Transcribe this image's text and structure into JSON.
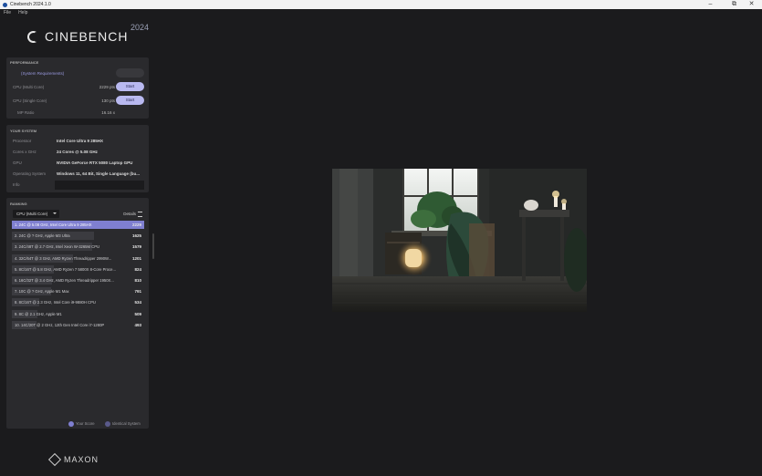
{
  "window": {
    "title": "Cinebench 2024.1.0"
  },
  "menu": {
    "items": [
      "File",
      "Help"
    ]
  },
  "logo": {
    "name": "CINEBENCH",
    "year": "2024"
  },
  "performance": {
    "title": "PERFORMANCE",
    "system_requirements": "(System Requirements)",
    "tests": [
      {
        "label": "CPU (Multi Core)",
        "score": "2229 pts",
        "button": "Start"
      },
      {
        "label": "CPU (Single Core)",
        "score": "130 pts",
        "button": "Start"
      }
    ],
    "mp_ratio": {
      "label": "MP Ratio",
      "value": "16.16 x"
    }
  },
  "system": {
    "title": "YOUR SYSTEM",
    "rows": [
      {
        "label": "Processor",
        "value": "Intel Core Ultra 9 285HX"
      },
      {
        "label": "Cores x GHz",
        "value": "24 Cores @ 5.08 GHz"
      },
      {
        "label": "GPU",
        "value": "NVIDIA GeForce RTX 5080 Laptop GPU"
      },
      {
        "label": "Operating System",
        "value": "Windows 11, 64 Bit, Single Language (bu..."
      },
      {
        "label": "Info",
        "value": ""
      }
    ]
  },
  "ranking": {
    "title": "RANKING",
    "dropdown": "CPU (Multi Core)",
    "details": "Details",
    "rows": [
      {
        "name": "1. 24C @ 5.08 GHz, Intel Core Ultra 9 285HX",
        "score": "2229",
        "fraction": 1.0
      },
      {
        "name": "2. 24C @ ? GHz, Apple M3 Ultra",
        "score": "1625",
        "fraction": 0.73
      },
      {
        "name": "3. 24C/48T @ 2.7 GHz, Intel Xeon W-3265M CPU",
        "score": "1579",
        "fraction": 0.71
      },
      {
        "name": "4. 32C/64T @ 3 GHz, AMD Ryzen Threadripper 2990W...",
        "score": "1201",
        "fraction": 0.54
      },
      {
        "name": "5. 8C/16T @ 5.8 GHz, AMD Ryzen 7 5800X 8-Core Proce...",
        "score": "824",
        "fraction": 0.37
      },
      {
        "name": "6. 16C/32T @ 3.4 GHz, AMD Ryzen Threadripper 1950X...",
        "score": "810",
        "fraction": 0.36
      },
      {
        "name": "7. 10C @ ? GHz, Apple M1 Max",
        "score": "791",
        "fraction": 0.35
      },
      {
        "name": "8. 8C/16T @ 2.3 GHz, Intel Core i9-9880H CPU",
        "score": "534",
        "fraction": 0.24
      },
      {
        "name": "9. 8C @ 2.1 GHz, Apple M1",
        "score": "509",
        "fraction": 0.23
      },
      {
        "name": "10. 14C/20T @ 2 GHz, 12th Gen Intel Core i7-1280P",
        "score": "493",
        "fraction": 0.22
      }
    ],
    "legend": {
      "your_score": "Your Score",
      "identical": "Identical System"
    }
  },
  "footer": {
    "brand": "MAXON"
  },
  "colors": {
    "accent": "#b9b9f0",
    "highlight": "#7f7fd0",
    "legend_yours": "#7f7fd0",
    "legend_identical": "#5a5a8a"
  }
}
